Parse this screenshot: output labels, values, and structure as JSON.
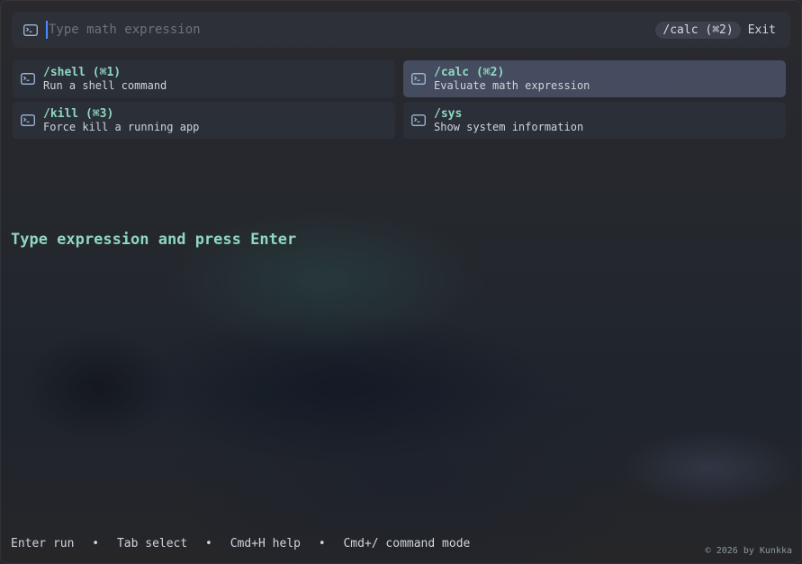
{
  "search": {
    "placeholder": "Type math expression",
    "value": "",
    "mode_chip": "/calc (⌘2)",
    "exit_label": "Exit"
  },
  "commands": [
    {
      "name": "/shell (⌘1)",
      "description": "Run a shell command",
      "icon": "terminal-icon",
      "selected": false
    },
    {
      "name": "/calc (⌘2)",
      "description": "Evaluate math expression",
      "icon": "terminal-icon",
      "selected": true
    },
    {
      "name": "/kill (⌘3)",
      "description": "Force kill a running app",
      "icon": "terminal-icon",
      "selected": false
    },
    {
      "name": "/sys",
      "description": "Show system information",
      "icon": "terminal-icon",
      "selected": false
    }
  ],
  "hint": "Type expression and press Enter",
  "footer": {
    "items": [
      "Enter run",
      "Tab select",
      "Cmd+H help",
      "Cmd+/ command mode"
    ],
    "separator": "•",
    "copyright": "© 2026 by Kunkka"
  },
  "colors": {
    "accent": "#8fd7c1",
    "caret": "#4a8cff",
    "selected_row": "#545f7a"
  }
}
